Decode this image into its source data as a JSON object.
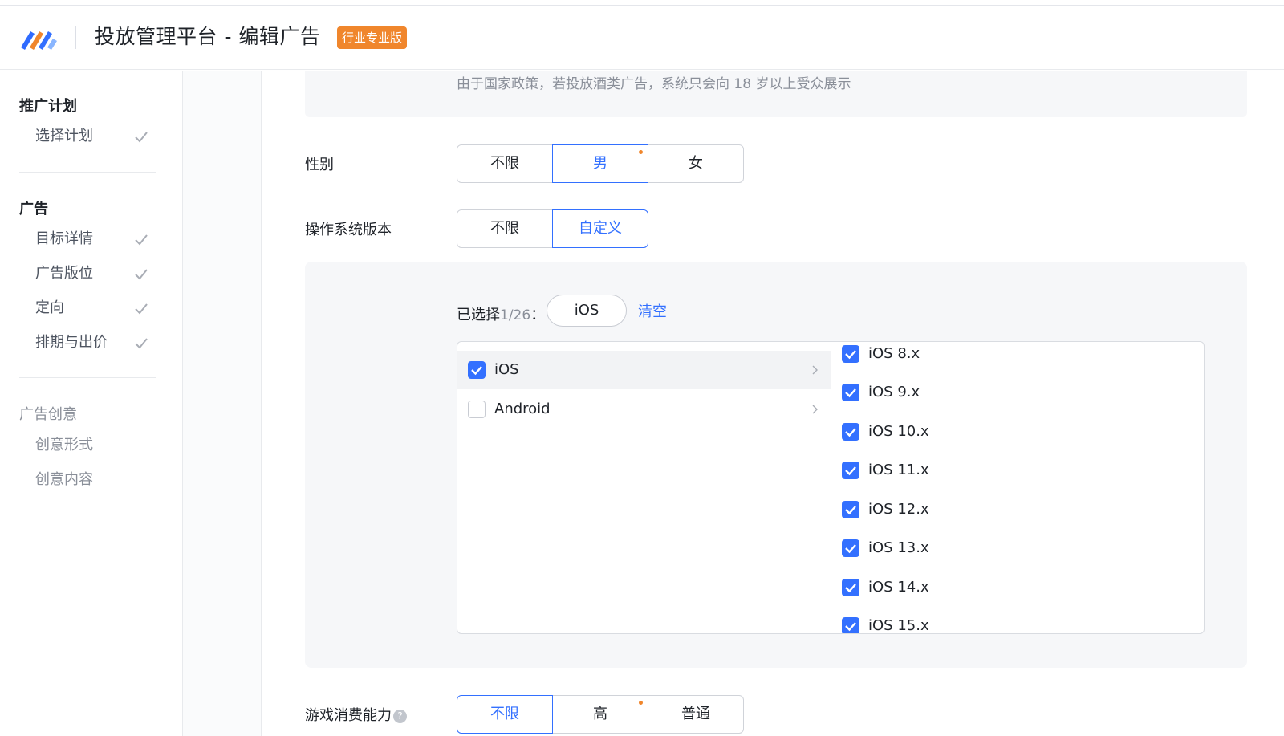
{
  "header": {
    "title": "投放管理平台 - 编辑广告",
    "badge": "行业专业版",
    "brand_colors": [
      "#3370ff",
      "#f0862c",
      "#7fb0ff"
    ]
  },
  "sidebar": {
    "groups": [
      {
        "title": "推广计划",
        "items": [
          {
            "label": "选择计划",
            "done": true
          }
        ]
      },
      {
        "title": "广告",
        "items": [
          {
            "label": "目标详情",
            "done": true
          },
          {
            "label": "广告版位",
            "done": true
          },
          {
            "label": "定向",
            "done": true
          },
          {
            "label": "排期与出价",
            "done": true
          }
        ]
      },
      {
        "title": "广告创意",
        "items": [
          {
            "label": "创意形式",
            "done": false
          },
          {
            "label": "创意内容",
            "done": false
          }
        ]
      }
    ],
    "check_icon": "check-icon"
  },
  "notice": "由于国家政策，若投放酒类广告，系统只会向 18 岁以上受众展示",
  "gender": {
    "label": "性别",
    "options": [
      "不限",
      "男",
      "女"
    ],
    "selected": "男"
  },
  "os_version": {
    "label": "操作系统版本",
    "options": [
      "不限",
      "自定义"
    ],
    "selected": "自定义",
    "selected_prefix": "已选择",
    "selected_count": "1/26",
    "selected_suffix": "：",
    "chip": "iOS",
    "clear": "清空",
    "categories": [
      {
        "label": "iOS",
        "checked": true,
        "active": true
      },
      {
        "label": "Android",
        "checked": false,
        "active": false
      }
    ],
    "versions": [
      {
        "label": "iOS 8.x",
        "checked": true
      },
      {
        "label": "iOS 9.x",
        "checked": true
      },
      {
        "label": "iOS 10.x",
        "checked": true
      },
      {
        "label": "iOS 11.x",
        "checked": true
      },
      {
        "label": "iOS 12.x",
        "checked": true
      },
      {
        "label": "iOS 13.x",
        "checked": true
      },
      {
        "label": "iOS 14.x",
        "checked": true
      },
      {
        "label": "iOS 15.x",
        "checked": true
      }
    ]
  },
  "game_spend": {
    "label": "游戏消费能力",
    "help": "?",
    "options": [
      "不限",
      "高",
      "普通"
    ],
    "selected": "不限"
  },
  "colors": {
    "accent": "#3370ff",
    "badge": "#f0862c",
    "muted_text": "#8a8f99"
  }
}
